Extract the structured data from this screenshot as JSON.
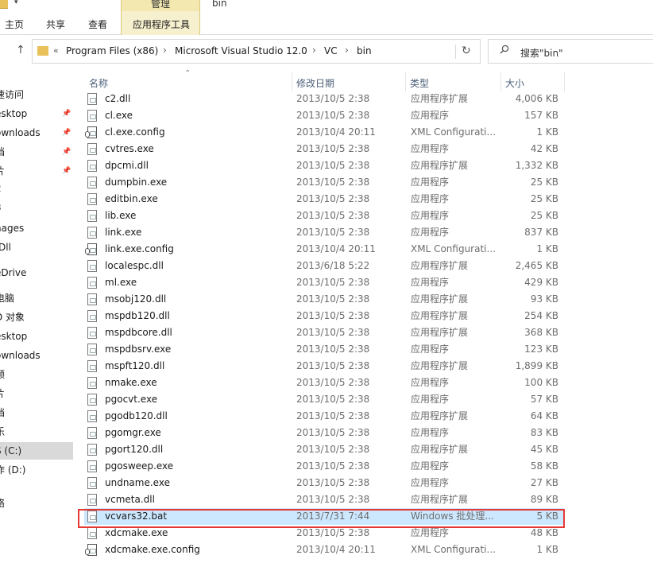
{
  "window": {
    "title": "bin",
    "context_tab_header": "管理"
  },
  "ribbon": {
    "tabs": [
      {
        "label": "主页"
      },
      {
        "label": "共享"
      },
      {
        "label": "查看"
      },
      {
        "label": "应用程序工具"
      }
    ]
  },
  "address_bar": {
    "overflow": "«",
    "crumbs": [
      "Program Files (x86)",
      "Microsoft Visual Studio 12.0",
      "VC",
      "bin"
    ]
  },
  "search": {
    "placeholder": "搜索\"bin\""
  },
  "nav_pane": {
    "items": [
      {
        "label": "速访问",
        "pinned": false
      },
      {
        "label": "esktop",
        "pinned": true
      },
      {
        "label": "ownloads",
        "pinned": true
      },
      {
        "label": "档",
        "pinned": true
      },
      {
        "label": "片",
        "pinned": true
      },
      {
        "label": "2",
        "pinned": false
      },
      {
        "label": "3",
        "pinned": false
      },
      {
        "label": "nages",
        "pinned": false
      },
      {
        "label": "/Dll",
        "pinned": false
      },
      {
        "label": "eDrive",
        "pinned": false
      },
      {
        "label": "电脑",
        "pinned": false
      },
      {
        "label": "D 对象",
        "pinned": false
      },
      {
        "label": "esktop",
        "pinned": false
      },
      {
        "label": "ownloads",
        "pinned": false
      },
      {
        "label": "频",
        "pinned": false
      },
      {
        "label": "片",
        "pinned": false
      },
      {
        "label": "档",
        "pinned": false
      },
      {
        "label": "乐",
        "pinned": false
      },
      {
        "label": "S (C:)",
        "pinned": false,
        "selected": true
      },
      {
        "label": "作 (D:)",
        "pinned": false
      },
      {
        "label": "",
        "pinned": false
      },
      {
        "label": "络",
        "pinned": false
      }
    ]
  },
  "columns": {
    "name": "名称",
    "modified": "修改日期",
    "type": "类型",
    "size": "大小"
  },
  "files": [
    {
      "name": "c2.dll",
      "modified": "2013/10/5 2:38",
      "type": "应用程序扩展",
      "size": "4,006 KB",
      "icon": "dll-icon"
    },
    {
      "name": "cl.exe",
      "modified": "2013/10/5 2:38",
      "type": "应用程序",
      "size": "157 KB",
      "icon": "exe-icon"
    },
    {
      "name": "cl.exe.config",
      "modified": "2013/10/4 20:11",
      "type": "XML Configurati...",
      "size": "1 KB",
      "icon": "config-icon"
    },
    {
      "name": "cvtres.exe",
      "modified": "2013/10/5 2:38",
      "type": "应用程序",
      "size": "42 KB",
      "icon": "exe-icon"
    },
    {
      "name": "dpcmi.dll",
      "modified": "2013/10/5 2:38",
      "type": "应用程序扩展",
      "size": "1,332 KB",
      "icon": "dll-icon"
    },
    {
      "name": "dumpbin.exe",
      "modified": "2013/10/5 2:38",
      "type": "应用程序",
      "size": "25 KB",
      "icon": "exe-icon"
    },
    {
      "name": "editbin.exe",
      "modified": "2013/10/5 2:38",
      "type": "应用程序",
      "size": "25 KB",
      "icon": "exe-icon"
    },
    {
      "name": "lib.exe",
      "modified": "2013/10/5 2:38",
      "type": "应用程序",
      "size": "25 KB",
      "icon": "exe-icon"
    },
    {
      "name": "link.exe",
      "modified": "2013/10/5 2:38",
      "type": "应用程序",
      "size": "837 KB",
      "icon": "exe-icon"
    },
    {
      "name": "link.exe.config",
      "modified": "2013/10/4 20:11",
      "type": "XML Configurati...",
      "size": "1 KB",
      "icon": "config-icon"
    },
    {
      "name": "localespc.dll",
      "modified": "2013/6/18 5:22",
      "type": "应用程序扩展",
      "size": "2,465 KB",
      "icon": "dll-icon"
    },
    {
      "name": "ml.exe",
      "modified": "2013/10/5 2:38",
      "type": "应用程序",
      "size": "429 KB",
      "icon": "exe-icon"
    },
    {
      "name": "msobj120.dll",
      "modified": "2013/10/5 2:38",
      "type": "应用程序扩展",
      "size": "93 KB",
      "icon": "dll-icon"
    },
    {
      "name": "mspdb120.dll",
      "modified": "2013/10/5 2:38",
      "type": "应用程序扩展",
      "size": "254 KB",
      "icon": "dll-icon"
    },
    {
      "name": "mspdbcore.dll",
      "modified": "2013/10/5 2:38",
      "type": "应用程序扩展",
      "size": "368 KB",
      "icon": "dll-icon"
    },
    {
      "name": "mspdbsrv.exe",
      "modified": "2013/10/5 2:38",
      "type": "应用程序",
      "size": "123 KB",
      "icon": "exe-icon"
    },
    {
      "name": "mspft120.dll",
      "modified": "2013/10/5 2:38",
      "type": "应用程序扩展",
      "size": "1,899 KB",
      "icon": "dll-icon"
    },
    {
      "name": "nmake.exe",
      "modified": "2013/10/5 2:38",
      "type": "应用程序",
      "size": "100 KB",
      "icon": "exe-icon"
    },
    {
      "name": "pgocvt.exe",
      "modified": "2013/10/5 2:38",
      "type": "应用程序",
      "size": "57 KB",
      "icon": "exe-icon"
    },
    {
      "name": "pgodb120.dll",
      "modified": "2013/10/5 2:38",
      "type": "应用程序扩展",
      "size": "64 KB",
      "icon": "dll-icon"
    },
    {
      "name": "pgomgr.exe",
      "modified": "2013/10/5 2:38",
      "type": "应用程序",
      "size": "83 KB",
      "icon": "exe-icon"
    },
    {
      "name": "pgort120.dll",
      "modified": "2013/10/5 2:38",
      "type": "应用程序扩展",
      "size": "45 KB",
      "icon": "dll-icon"
    },
    {
      "name": "pgosweep.exe",
      "modified": "2013/10/5 2:38",
      "type": "应用程序",
      "size": "58 KB",
      "icon": "exe-icon"
    },
    {
      "name": "undname.exe",
      "modified": "2013/10/5 2:38",
      "type": "应用程序",
      "size": "27 KB",
      "icon": "exe-icon"
    },
    {
      "name": "vcmeta.dll",
      "modified": "2013/10/5 2:38",
      "type": "应用程序扩展",
      "size": "89 KB",
      "icon": "dll-icon"
    },
    {
      "name": "vcvars32.bat",
      "modified": "2013/7/31 7:44",
      "type": "Windows 批处理...",
      "size": "5 KB",
      "icon": "bat-icon",
      "selected": true
    },
    {
      "name": "xdcmake.exe",
      "modified": "2013/10/5 2:38",
      "type": "应用程序",
      "size": "48 KB",
      "icon": "exe-icon"
    },
    {
      "name": "xdcmake.exe.config",
      "modified": "2013/10/4 20:11",
      "type": "XML Configurati...",
      "size": "1 KB",
      "icon": "config-icon"
    }
  ],
  "colors": {
    "selection": "#cce8ff",
    "highlight_box": "#e53935",
    "context_tab": "#f7f0cf",
    "header_text": "#4c607a"
  }
}
